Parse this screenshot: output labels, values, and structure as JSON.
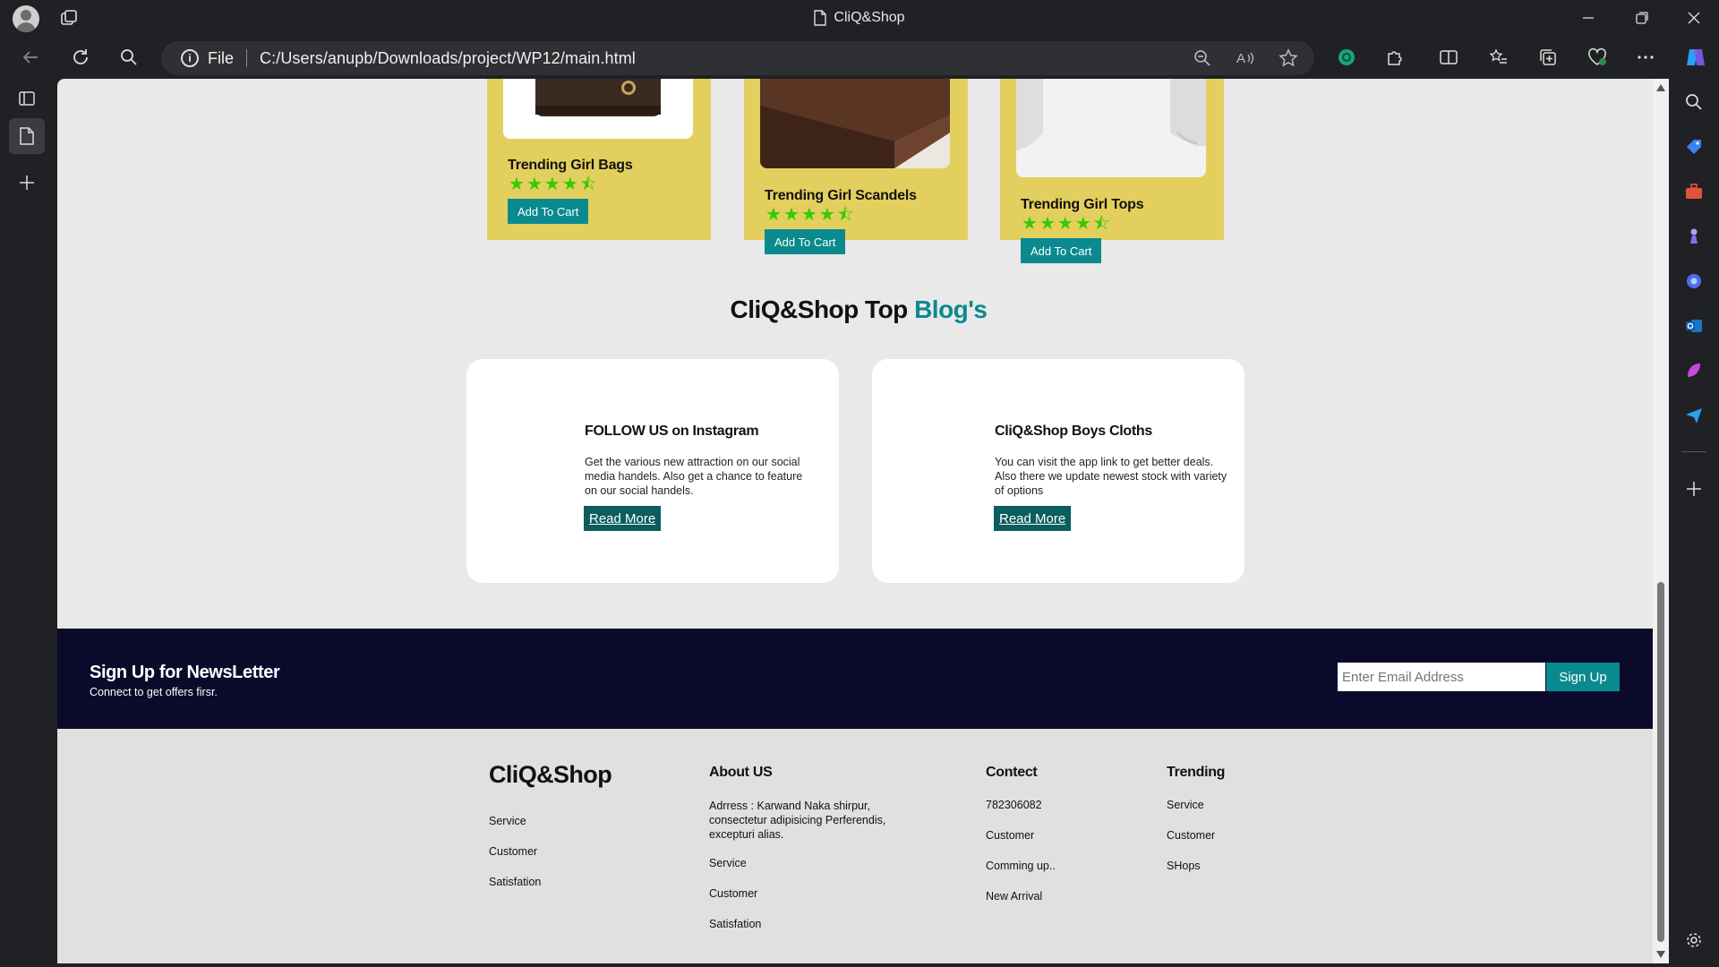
{
  "browser": {
    "window_title": "CliQ&Shop",
    "address": {
      "scheme": "File",
      "url": "C:/Users/anupb/Downloads/project/WP12/main.html"
    }
  },
  "products": [
    {
      "name": "Trending Girl Bags",
      "rating": 4.5,
      "button": "Add To Cart"
    },
    {
      "name": "Trending Girl Scandels",
      "rating": 4.5,
      "button": "Add To Cart"
    },
    {
      "name": "Trending Girl Tops",
      "rating": 4.5,
      "button": "Add To Cart"
    }
  ],
  "blog": {
    "heading_main": "CliQ&Shop Top",
    "heading_accent": "Blog's",
    "cards": [
      {
        "title": "FOLLOW US on Instagram",
        "desc": "Get the various new attraction on our social media handels. Also get a chance to feature on our social handels.",
        "button": "Read More"
      },
      {
        "title": "CliQ&Shop Boys Cloths",
        "desc": "You can visit the app link to get better deals. Also there we update newest stock with variety of options",
        "button": "Read More"
      }
    ]
  },
  "newsletter": {
    "title": "Sign Up for NewsLetter",
    "subtitle": "Connect to get offers firsr.",
    "email_placeholder": "Enter Email Address",
    "button": "Sign Up"
  },
  "footer": {
    "brand": "CliQ&Shop",
    "brand_links": [
      "Service",
      "Customer",
      "Satisfation"
    ],
    "about": {
      "title": "About US",
      "address": "Adrress : Karwand Naka shirpur, consectetur adipisicing Perferendis, excepturi alias.",
      "links": [
        "Service",
        "Customer",
        "Satisfation"
      ]
    },
    "contact": {
      "title": "Contect",
      "links": [
        "782306082",
        "Customer",
        "Comming up..",
        "New Arrival"
      ]
    },
    "trending": {
      "title": "Trending",
      "links": [
        "Service",
        "Customer",
        "SHops"
      ]
    }
  },
  "colors": {
    "accent": "#0a8a8f",
    "card_yellow": "#e3cf5d",
    "newsletter_bg": "#0b0a2b",
    "star_green": "#33cc00"
  }
}
